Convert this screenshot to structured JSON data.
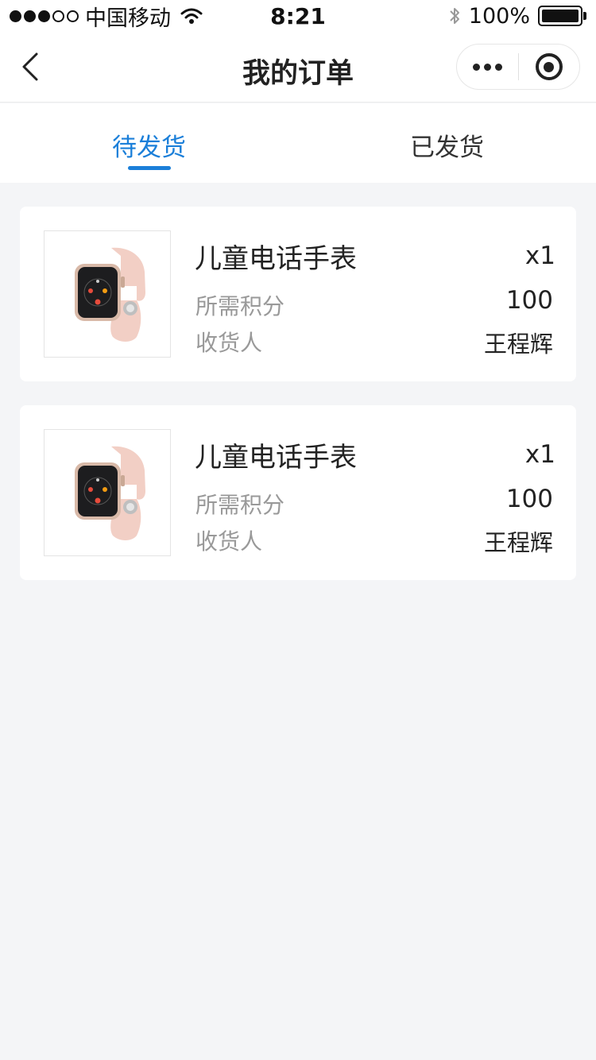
{
  "status_bar": {
    "carrier": "中国移动",
    "time": "8:21",
    "battery_text": "100%"
  },
  "nav": {
    "title": "我的订单"
  },
  "tabs": [
    {
      "label": "待发货",
      "active": true
    },
    {
      "label": "已发货",
      "active": false
    }
  ],
  "colors": {
    "accent": "#1b7fd9",
    "background": "#f4f5f7",
    "muted_text": "#999999"
  },
  "orders": [
    {
      "name": "儿童电话手表",
      "quantity": "x1",
      "points_label": "所需积分",
      "points": "100",
      "recipient_label": "收货人",
      "recipient": "王程辉",
      "image_icon": "watch-icon"
    },
    {
      "name": "儿童电话手表",
      "quantity": "x1",
      "points_label": "所需积分",
      "points": "100",
      "recipient_label": "收货人",
      "recipient": "王程辉",
      "image_icon": "watch-icon"
    }
  ]
}
